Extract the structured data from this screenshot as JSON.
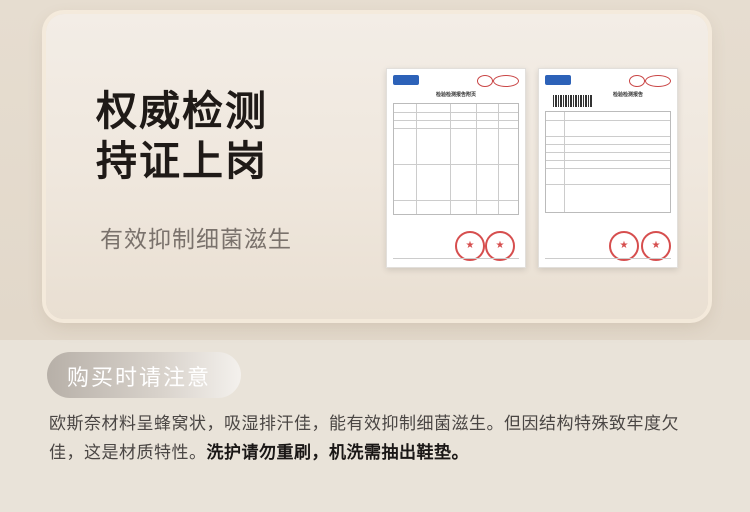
{
  "hero": {
    "title_line1": "权威检测",
    "title_line2": "持证上岗",
    "subtitle": "有效抑制细菌滋生"
  },
  "documents": [
    {
      "name": "test-report-attachment",
      "title": "检验检测报告附页"
    },
    {
      "name": "test-report",
      "title": "检验检测报告"
    }
  ],
  "notice": {
    "label": "购买时请注意",
    "text_normal": "欧斯奈材料呈蜂窝状，吸湿排汗佳，能有效抑制细菌滋生。但因结构特殊致牢度欠佳，这是材质特性。",
    "text_bold": "洗护请勿重刷，机洗需抽出鞋垫。"
  },
  "colors": {
    "background": "#e9e3d9",
    "stamp_red": "#d23b3b",
    "logo_blue": "#2d62b8"
  }
}
